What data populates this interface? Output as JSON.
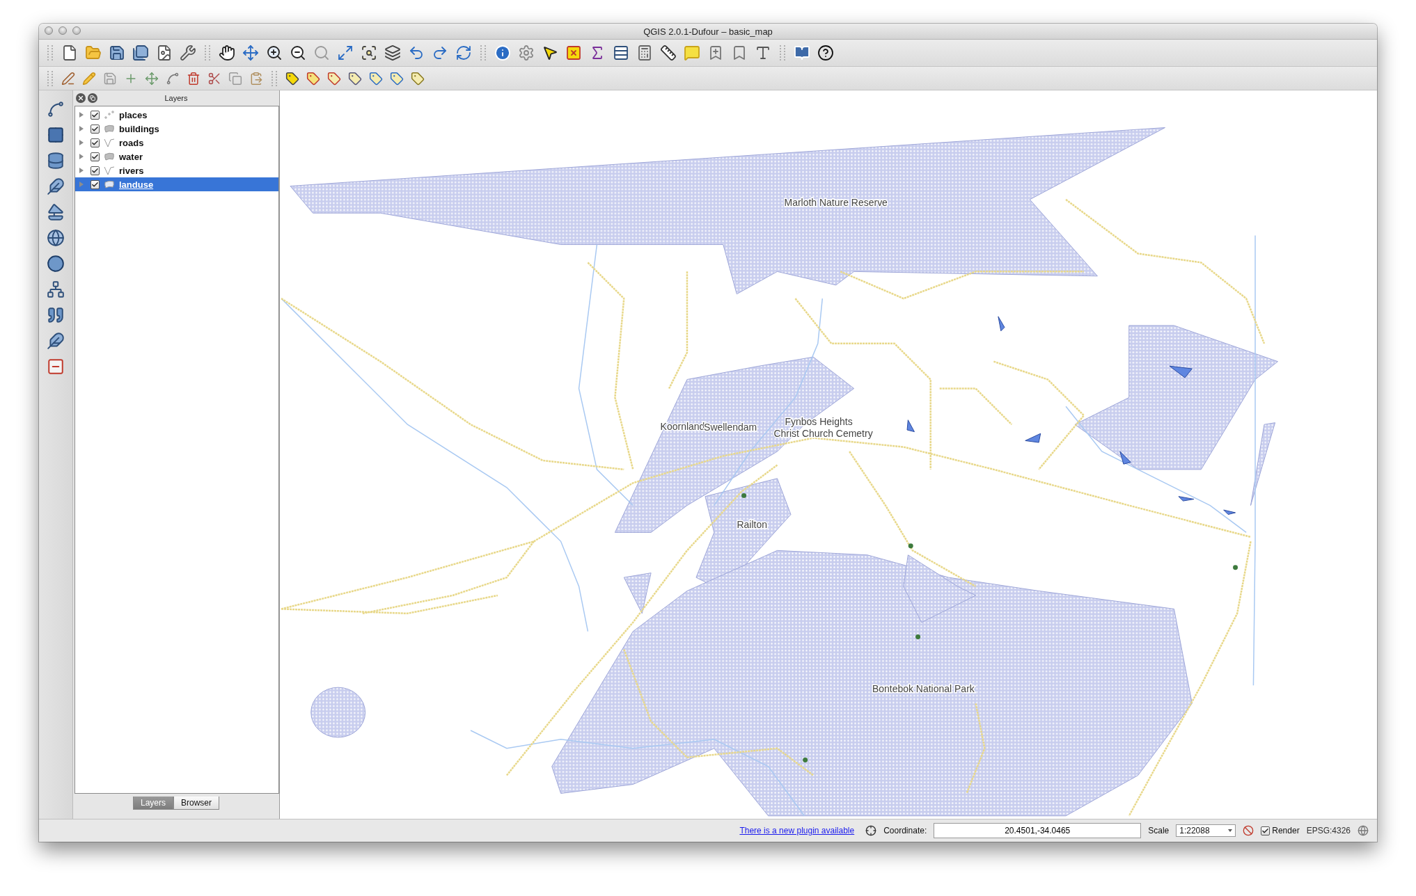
{
  "window": {
    "title": "QGIS 2.0.1-Dufour – basic_map"
  },
  "layers_panel": {
    "title": "Layers",
    "layers": [
      {
        "name": "places",
        "kind": "point",
        "checked": true,
        "selected": false
      },
      {
        "name": "buildings",
        "kind": "polygon",
        "checked": true,
        "selected": false
      },
      {
        "name": "roads",
        "kind": "line",
        "checked": true,
        "selected": false
      },
      {
        "name": "water",
        "kind": "polygon",
        "checked": true,
        "selected": false
      },
      {
        "name": "rivers",
        "kind": "line",
        "checked": true,
        "selected": false
      },
      {
        "name": "landuse",
        "kind": "polygon",
        "checked": true,
        "selected": true
      }
    ]
  },
  "panel_tabs": [
    {
      "label": "Layers",
      "selected": true
    },
    {
      "label": "Browser",
      "selected": false
    }
  ],
  "map": {
    "labels": [
      {
        "text": "Marloth Nature Reserve"
      },
      {
        "text": "Koornland"
      },
      {
        "text": "Swellendam"
      },
      {
        "text": "Fynbos Heights"
      },
      {
        "text": "Christ Church Cemetry"
      },
      {
        "text": "Railton"
      },
      {
        "text": "Bontebok National Park"
      }
    ]
  },
  "status_bar": {
    "plugin_link": "There is a new plugin available",
    "coordinate_label": "Coordinate:",
    "coordinate_value": "20.4501,-34.0465",
    "scale_label": "Scale",
    "scale_value": "1:22088",
    "render": {
      "label": "Render",
      "checked": true
    },
    "crs": "EPSG:4326"
  }
}
